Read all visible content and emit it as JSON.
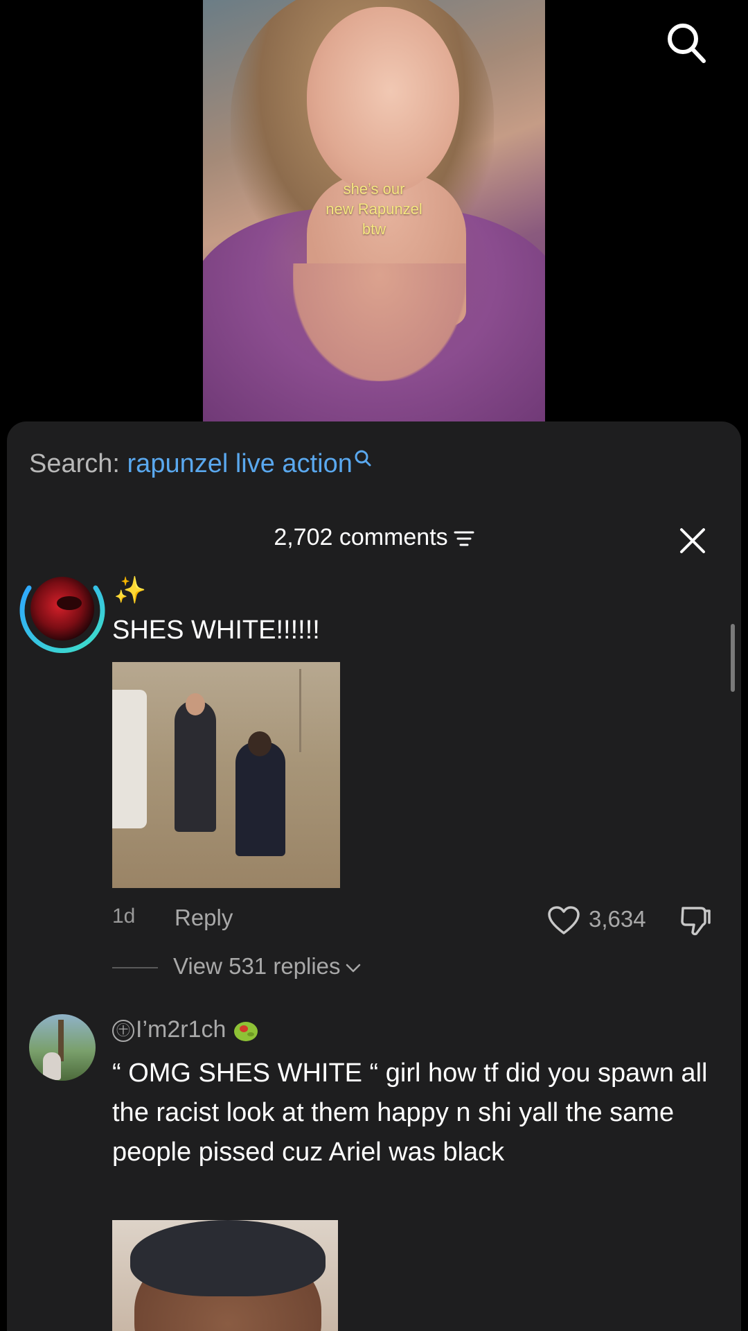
{
  "video": {
    "caption_lines": [
      "she’s our",
      "new Rapunzel",
      "btw"
    ]
  },
  "panel": {
    "search_label": "Search:",
    "search_query": "rapunzel live action",
    "comments_count": "2,702 comments"
  },
  "comments": [
    {
      "username": "",
      "emoji": "✨",
      "text": "SHES WHITE!!!!!!",
      "time": "1d",
      "reply_label": "Reply",
      "likes": "3,634",
      "view_replies": "View 531 replies"
    },
    {
      "username": "I’m2r1ch",
      "user_mark": "㊉",
      "text": "“ OMG SHES WHITE “ girl how tf did you spawn all the racist look at them happy n shi yall the same people pissed cuz Ariel was black"
    }
  ],
  "icons": {
    "top_search": "search-icon",
    "sort": "sort-icon",
    "close": "close-icon",
    "like": "heart-icon",
    "dislike": "thumbs-down-icon",
    "chevron": "chevron-down-icon",
    "olive": "olive-emoji-icon"
  },
  "colors": {
    "accent_blue": "#5aa8ee",
    "panel_bg": "#1e1e1f",
    "caption_yellow": "#f6e680",
    "ring_teal": "#3fe0c5"
  }
}
